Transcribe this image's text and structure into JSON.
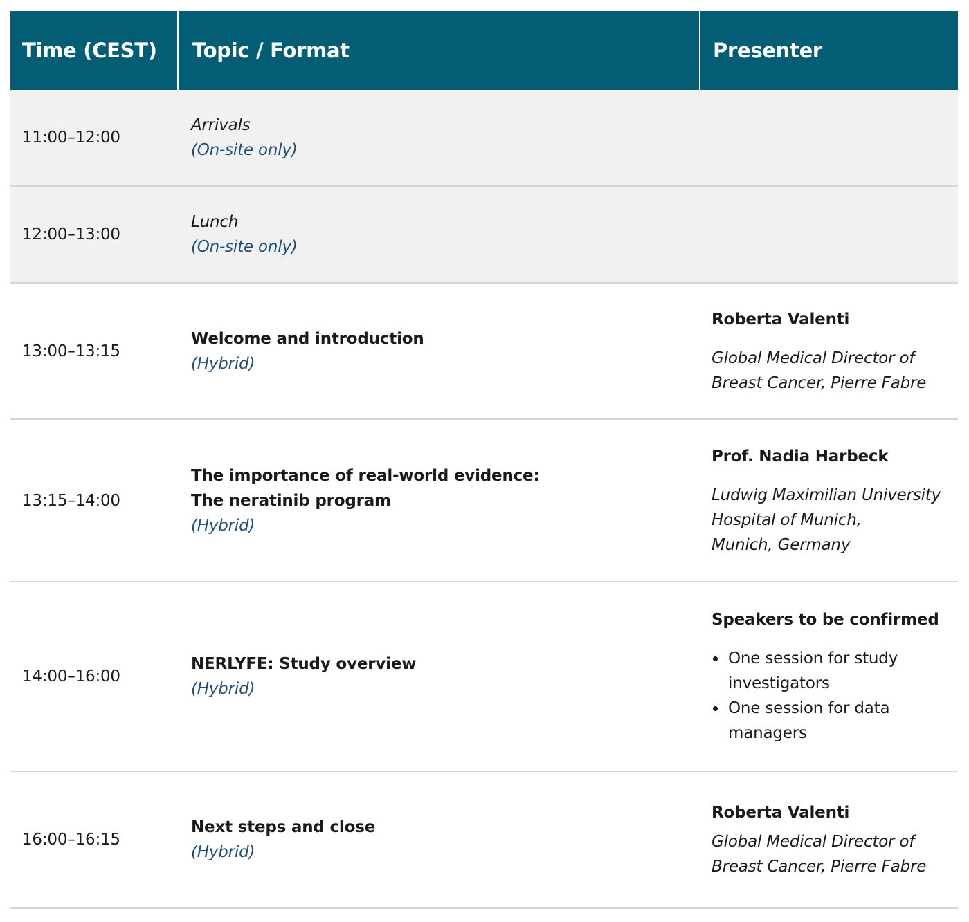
{
  "header": {
    "time": "Time (CEST)",
    "topic": "Topic / Format",
    "presenter": "Presenter"
  },
  "rows": [
    {
      "time": "11:00–12:00",
      "topic": "Arrivals",
      "format": "(On-site only)"
    },
    {
      "time": "12:00–13:00",
      "topic": "Lunch",
      "format": "(On-site only)"
    },
    {
      "time": "13:00–13:15",
      "topic": "Welcome and introduction",
      "format": "(Hybrid)",
      "presenter_name": "Roberta Valenti",
      "presenter_affiliation": [
        "Global Medical Director of",
        "Breast Cancer, Pierre Fabre"
      ]
    },
    {
      "time": "13:15–14:00",
      "topic": [
        "The importance of real-world evidence:",
        "The neratinib program"
      ],
      "format": "(Hybrid)",
      "presenter_name": "Prof. Nadia Harbeck",
      "presenter_affiliation": [
        "Ludwig Maximilian University",
        "Hospital of Munich,",
        "Munich, Germany"
      ]
    },
    {
      "time": "14:00–16:00",
      "topic": "NERLYFE: Study overview",
      "format": "(Hybrid)",
      "presenter_name": "Speakers to be confirmed",
      "presenter_bullets": [
        [
          "One session for study",
          "investigators"
        ],
        [
          "One session for data",
          "managers"
        ]
      ]
    },
    {
      "time": "16:00–16:15",
      "topic": "Next steps and close",
      "format": "(Hybrid)",
      "presenter_name": "Roberta Valenti",
      "presenter_affiliation": [
        "Global Medical Director of",
        "Breast Cancer, Pierre Fabre"
      ]
    }
  ],
  "colors": {
    "header_bg": "#035d75",
    "shaded_row_bg": "#f1f1f1",
    "format_text": "#1f4e79"
  }
}
